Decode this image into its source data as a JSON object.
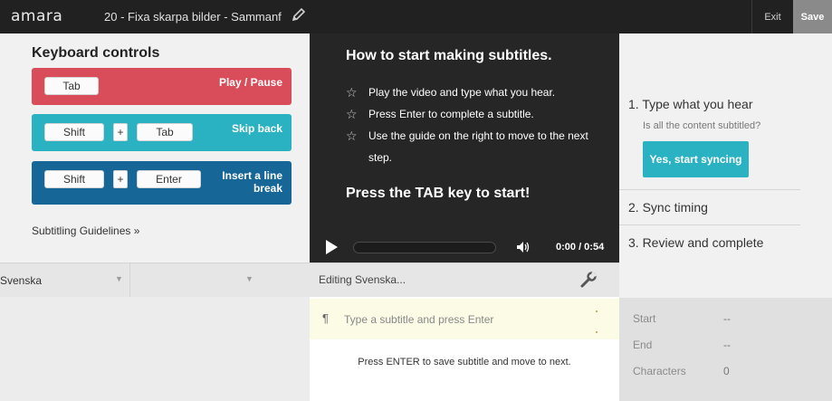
{
  "app": {
    "logo": "amara",
    "title": "20 - Fixa skarpa bilder - Sammanf",
    "exit_label": "Exit",
    "save_label": "Save"
  },
  "keyboard": {
    "title": "Keyboard controls",
    "rows": [
      {
        "keys": [
          "Tab"
        ],
        "action": "Play / Pause"
      },
      {
        "keys": [
          "Shift",
          "+",
          "Tab"
        ],
        "action": "Skip back"
      },
      {
        "keys": [
          "Shift",
          "+",
          "Enter"
        ],
        "action_line1": "Insert a line",
        "action_line2": "break"
      }
    ],
    "guidelines_link": "Subtitling Guidelines »"
  },
  "languages": {
    "left": "Svenska",
    "right": ""
  },
  "video": {
    "heading": "How to start making subtitles.",
    "steps": [
      "Play the video and type what you hear.",
      "Press Enter to complete a subtitle.",
      "Use the guide on the right to move to the next step."
    ],
    "cta": "Press the TAB key to start!",
    "time": "0:00 / 0:54",
    "progress": 0
  },
  "editor": {
    "label": "Editing Svenska...",
    "placeholder": "Type a subtitle and press Enter",
    "hint": "Press ENTER to save subtitle and move to next."
  },
  "workflow": {
    "step1": "1. Type what you hear",
    "question": "Is all the content subtitled?",
    "yes_button": "Yes, start syncing",
    "step2": "2. Sync timing",
    "step3": "3. Review and complete"
  },
  "info": {
    "start_label": "Start",
    "start_value": "--",
    "end_label": "End",
    "end_value": "--",
    "chars_label": "Characters",
    "chars_value": "0"
  },
  "colors": {
    "red": "#d94c59",
    "teal": "#2ab2c3",
    "blue": "#176698"
  },
  "icons": [
    "pencil-icon",
    "play-icon",
    "volume-icon",
    "wrench-icon",
    "star-icon",
    "pilcrow-icon",
    "dropdown-arrow-icon"
  ]
}
